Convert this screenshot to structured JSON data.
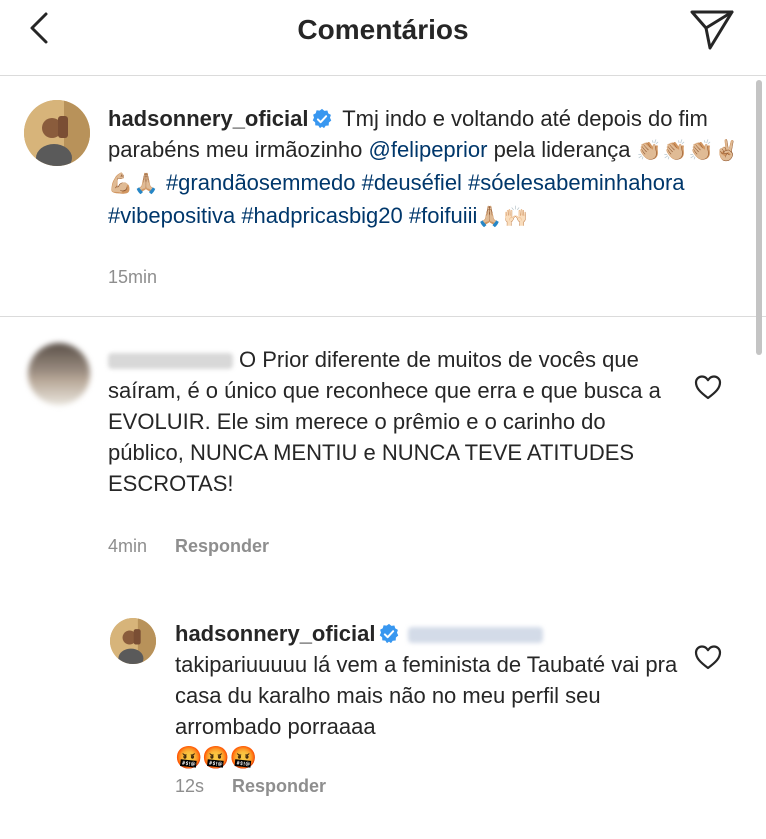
{
  "header": {
    "title": "Comentários",
    "back_icon": "chevron-left-icon",
    "send_icon": "paper-plane-icon"
  },
  "caption": {
    "username": "hadsonnery_oficial",
    "text_1": "Tmj indo e voltando até depois do fim parabéns meu irmãozinho",
    "mention": "@felipeprior",
    "text_2": "pela liderança",
    "emojis_1": "👏🏼👏🏼👏🏼✌🏼💪🏼🙏🏼",
    "hashtags_line1": "#grandãosemmedo",
    "hashtags_line2": "#deuséfiel #sóelesabeminhahora #vibepositiva",
    "hashtags_line3": "#hadpricasbig20 #foifuiii",
    "emojis_2": "🙏🏼🙌🏻",
    "time": "15min"
  },
  "comment1": {
    "text": "O Prior diferente de muitos de vocês que saíram, é o único que reconhece que erra e que busca a EVOLUIR. Ele sim merece o prêmio e o carinho do público, NUNCA MENTIU e NUNCA TEVE ATITUDES ESCROTAS!",
    "time": "4min",
    "reply_label": "Responder"
  },
  "comment2": {
    "username": "hadsonnery_oficial",
    "text": "takipariuuuuu lá vem a feminista de Taubaté vai pra casa du karalho mais não no meu perfil seu arrombado porraaaa",
    "emojis": "🤬🤬🤬",
    "time": "12s",
    "reply_label": "Responder"
  },
  "colors": {
    "link": "#00376b",
    "verified": "#3897f0",
    "muted": "#8e8e8e",
    "divider": "#dbdbdb"
  }
}
